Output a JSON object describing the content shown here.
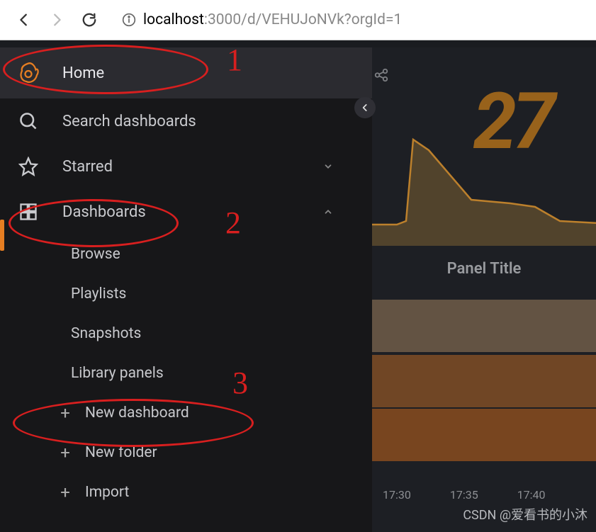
{
  "browser": {
    "url_host": "localhost",
    "url_rest": ":3000/d/VEHUJoNVk?orgId=1"
  },
  "sidebar": {
    "home": "Home",
    "search": "Search dashboards",
    "starred": {
      "label": "Starred",
      "expanded": false
    },
    "dashboards": {
      "label": "Dashboards",
      "expanded": true,
      "items": [
        {
          "label": "Browse"
        },
        {
          "label": "Playlists"
        },
        {
          "label": "Snapshots"
        },
        {
          "label": "Library panels"
        },
        {
          "label": "New dashboard",
          "icon": "plus"
        },
        {
          "label": "New folder",
          "icon": "plus"
        },
        {
          "label": "Import",
          "icon": "plus"
        }
      ]
    }
  },
  "main": {
    "big_number": "27",
    "panel_title": "Panel Title",
    "time_ticks": [
      "17:30",
      "17:35",
      "17:40"
    ]
  },
  "annotations": {
    "n1": "1",
    "n2": "2",
    "n3": "3"
  },
  "chart_data": {
    "type": "line",
    "title": "Panel Title",
    "xlabel": "",
    "ylabel": "",
    "x": [
      0,
      1,
      2,
      3,
      4,
      5,
      6,
      7,
      8,
      9
    ],
    "values": [
      20,
      20,
      20,
      85,
      75,
      42,
      40,
      38,
      30,
      28
    ],
    "ylim": [
      0,
      100
    ]
  },
  "watermark": "CSDN @爱看书的小沐"
}
